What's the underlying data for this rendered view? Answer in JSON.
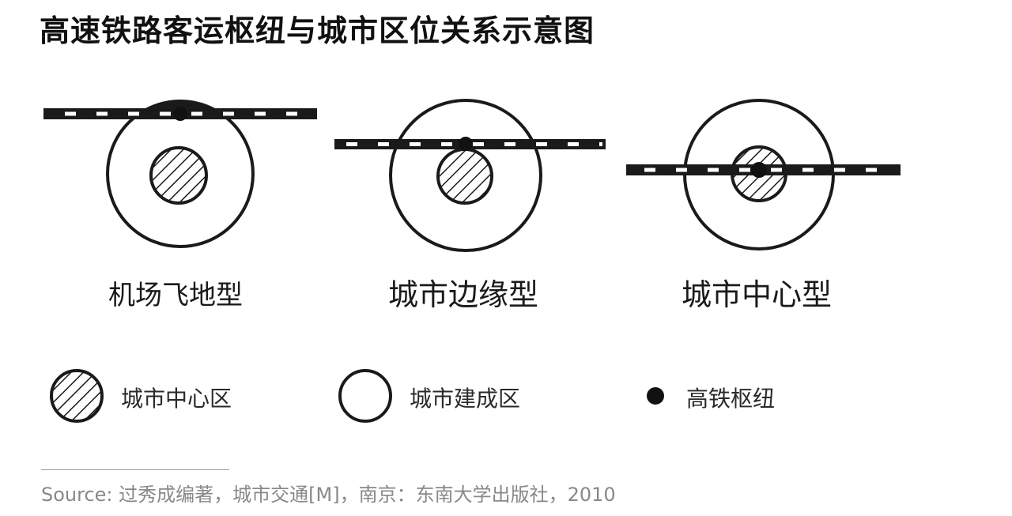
{
  "title": "高速铁路客运枢纽与城市区位关系示意图",
  "types": [
    {
      "label": "机场飞地型"
    },
    {
      "label": "城市边缘型"
    },
    {
      "label": "城市中心型"
    }
  ],
  "legend": {
    "center_area": "城市中心区",
    "built_area": "城市建成区",
    "hub": "高铁枢纽"
  },
  "source": "Source: 过秀成编著，城市交通[M]，南京：东南大学出版社，2010"
}
